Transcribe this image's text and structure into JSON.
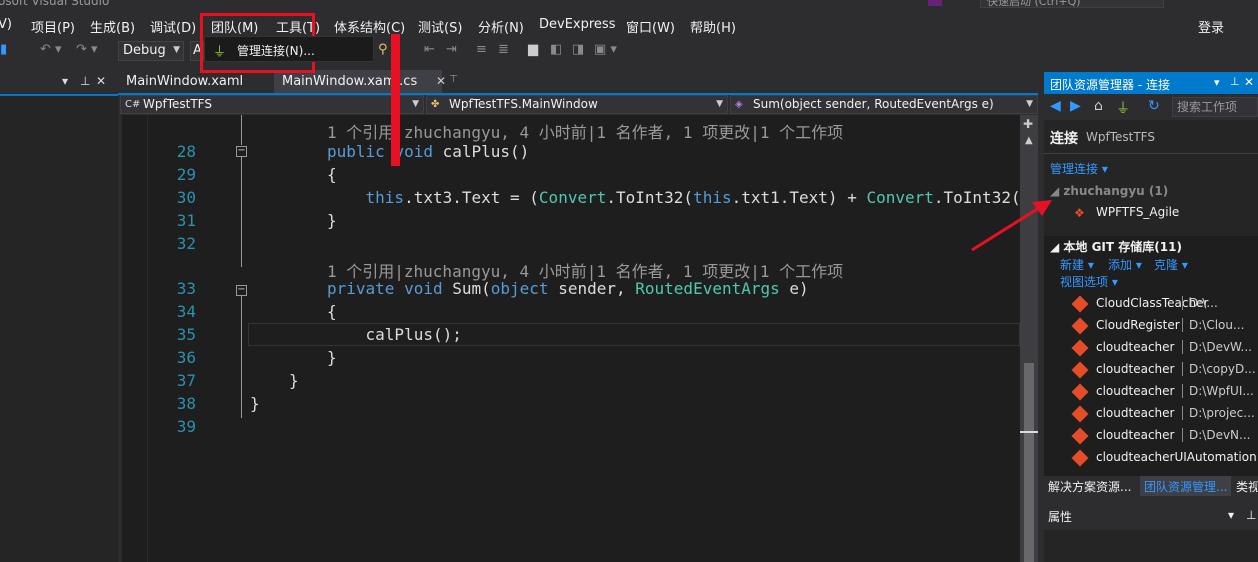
{
  "window": {
    "title": "osoft Visual Studio",
    "quick_launch": "快速启动 (Ctrl+Q)"
  },
  "menu": {
    "items": [
      "V)",
      "项目(P)",
      "生成(B)",
      "调试(D)",
      "团队(M)",
      "工具(T)",
      "体系结构(C)",
      "测试(S)",
      "分析(N)",
      "DevExpress",
      "窗口(W)",
      "帮助(H)"
    ],
    "login": "登录"
  },
  "dropdown": {
    "item": "管理连接(N)..."
  },
  "toolbar": {
    "config": "Debug",
    "platform": "A"
  },
  "tabs": [
    {
      "label": "MainWindow.xaml"
    },
    {
      "label": "MainWindow.xaml.cs"
    }
  ],
  "navbar": {
    "project": "WpfTestTFS",
    "class": "WpfTestTFS.MainWindow",
    "member": "Sum(object sender, RoutedEventArgs e)"
  },
  "editor": {
    "lens1": "1 个引用|zhuchangyu, 4 小时前|1 名作者, 1 项更改|1 个工作项",
    "lens2": "1 个引用|zhuchangyu, 4 小时前|1 名作者, 1 项更改|1 个工作项",
    "lines": [
      {
        "n": "28",
        "parts": [
          [
            "kw",
            "public "
          ],
          [
            "kw",
            "void "
          ],
          [
            "",
            "calPlus()"
          ]
        ]
      },
      {
        "n": "29",
        "parts": [
          [
            "",
            "{"
          ]
        ]
      },
      {
        "n": "30",
        "parts": [
          [
            "",
            "    "
          ],
          [
            "kw",
            "this"
          ],
          [
            "",
            ".txt3.Text = ("
          ],
          [
            "ty",
            "Convert"
          ],
          [
            "",
            ".ToInt32("
          ],
          [
            "kw",
            "this"
          ],
          [
            "",
            ".txt1.Text) + "
          ],
          [
            "ty",
            "Convert"
          ],
          [
            "",
            ".ToInt32("
          ],
          [
            "kw",
            "t"
          ]
        ]
      },
      {
        "n": "31",
        "parts": [
          [
            "",
            "}"
          ]
        ]
      },
      {
        "n": "32",
        "parts": []
      },
      {
        "n": "33",
        "parts": [
          [
            "kw",
            "private "
          ],
          [
            "kw",
            "void "
          ],
          [
            "",
            "Sum("
          ],
          [
            "kw",
            "object "
          ],
          [
            "",
            "sender, "
          ],
          [
            "ty",
            "RoutedEventArgs "
          ],
          [
            "",
            "e)"
          ]
        ]
      },
      {
        "n": "34",
        "parts": [
          [
            "",
            "{"
          ]
        ]
      },
      {
        "n": "35",
        "parts": [
          [
            "",
            "    calPlus();"
          ]
        ]
      },
      {
        "n": "36",
        "parts": [
          [
            "",
            "}"
          ]
        ]
      },
      {
        "n": "37",
        "parts": [
          [
            "",
            "}"
          ]
        ]
      },
      {
        "n": "38",
        "parts": [
          [
            "",
            "}"
          ]
        ]
      },
      {
        "n": "39",
        "parts": []
      }
    ]
  },
  "team_explorer": {
    "title": "团队资源管理器 - 连接",
    "search_placeholder": "搜索工作项",
    "heading": "连接",
    "project": "WpfTestTFS",
    "manage": "管理连接 ▾",
    "server": "zhuchangyu (1)",
    "team_project": "WPFTFS_Agile",
    "git_section": "本地 GIT 存储库(11)",
    "new": "新建 ▾",
    "add": "添加 ▾",
    "clone": "克隆 ▾",
    "view_options": "视图选项 ▾",
    "repos": [
      {
        "name": "CloudClassTeacher",
        "path": "D:\\..."
      },
      {
        "name": "CloudRegister",
        "path": "D:\\Clou..."
      },
      {
        "name": "cloudteacher",
        "path": "D:\\DevW..."
      },
      {
        "name": "cloudteacher",
        "path": "D:\\copyD..."
      },
      {
        "name": "cloudteacher",
        "path": "D:\\WpfUI..."
      },
      {
        "name": "cloudteacher",
        "path": "D:\\projec..."
      },
      {
        "name": "cloudteacher",
        "path": "D:\\DevN..."
      },
      {
        "name": "cloudteacherUIAutomation",
        "path": ""
      }
    ]
  },
  "bottom_tabs": [
    "解决方案资源...",
    "团队资源管理...",
    "类视"
  ],
  "properties": {
    "title": "属性"
  },
  "colors": {
    "accent": "#007acc",
    "annotation": "#e81123",
    "keyword": "#569cd6",
    "type": "#4ec9b0",
    "linenum": "#2b91af"
  }
}
